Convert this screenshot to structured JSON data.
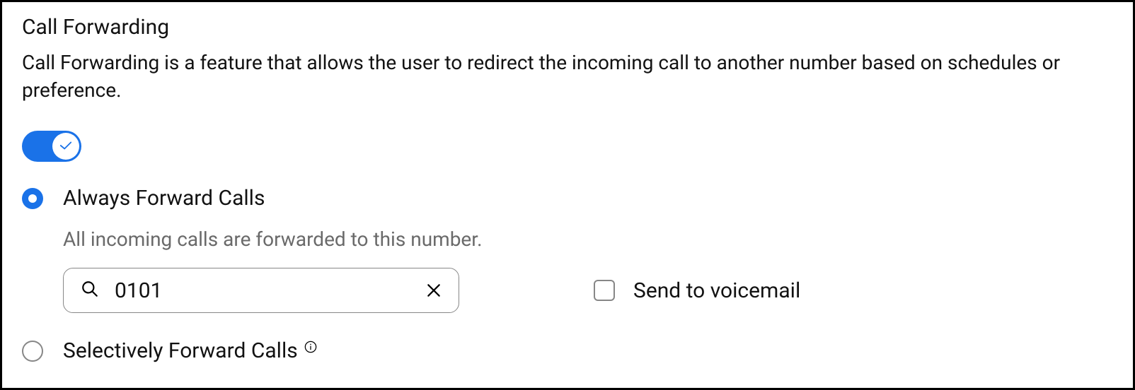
{
  "panel": {
    "title": "Call Forwarding",
    "description": "Call Forwarding is a feature that allows the user to redirect the incoming call to another number based on schedules or preference."
  },
  "toggle": {
    "enabled": true
  },
  "options": {
    "always": {
      "label": "Always Forward Calls",
      "selected": true,
      "description": "All incoming calls are forwarded to this number.",
      "number_value": "0101",
      "voicemail": {
        "label": "Send to voicemail",
        "checked": false
      }
    },
    "selective": {
      "label": "Selectively Forward Calls",
      "selected": false
    }
  },
  "colors": {
    "accent": "#1A72E8"
  }
}
